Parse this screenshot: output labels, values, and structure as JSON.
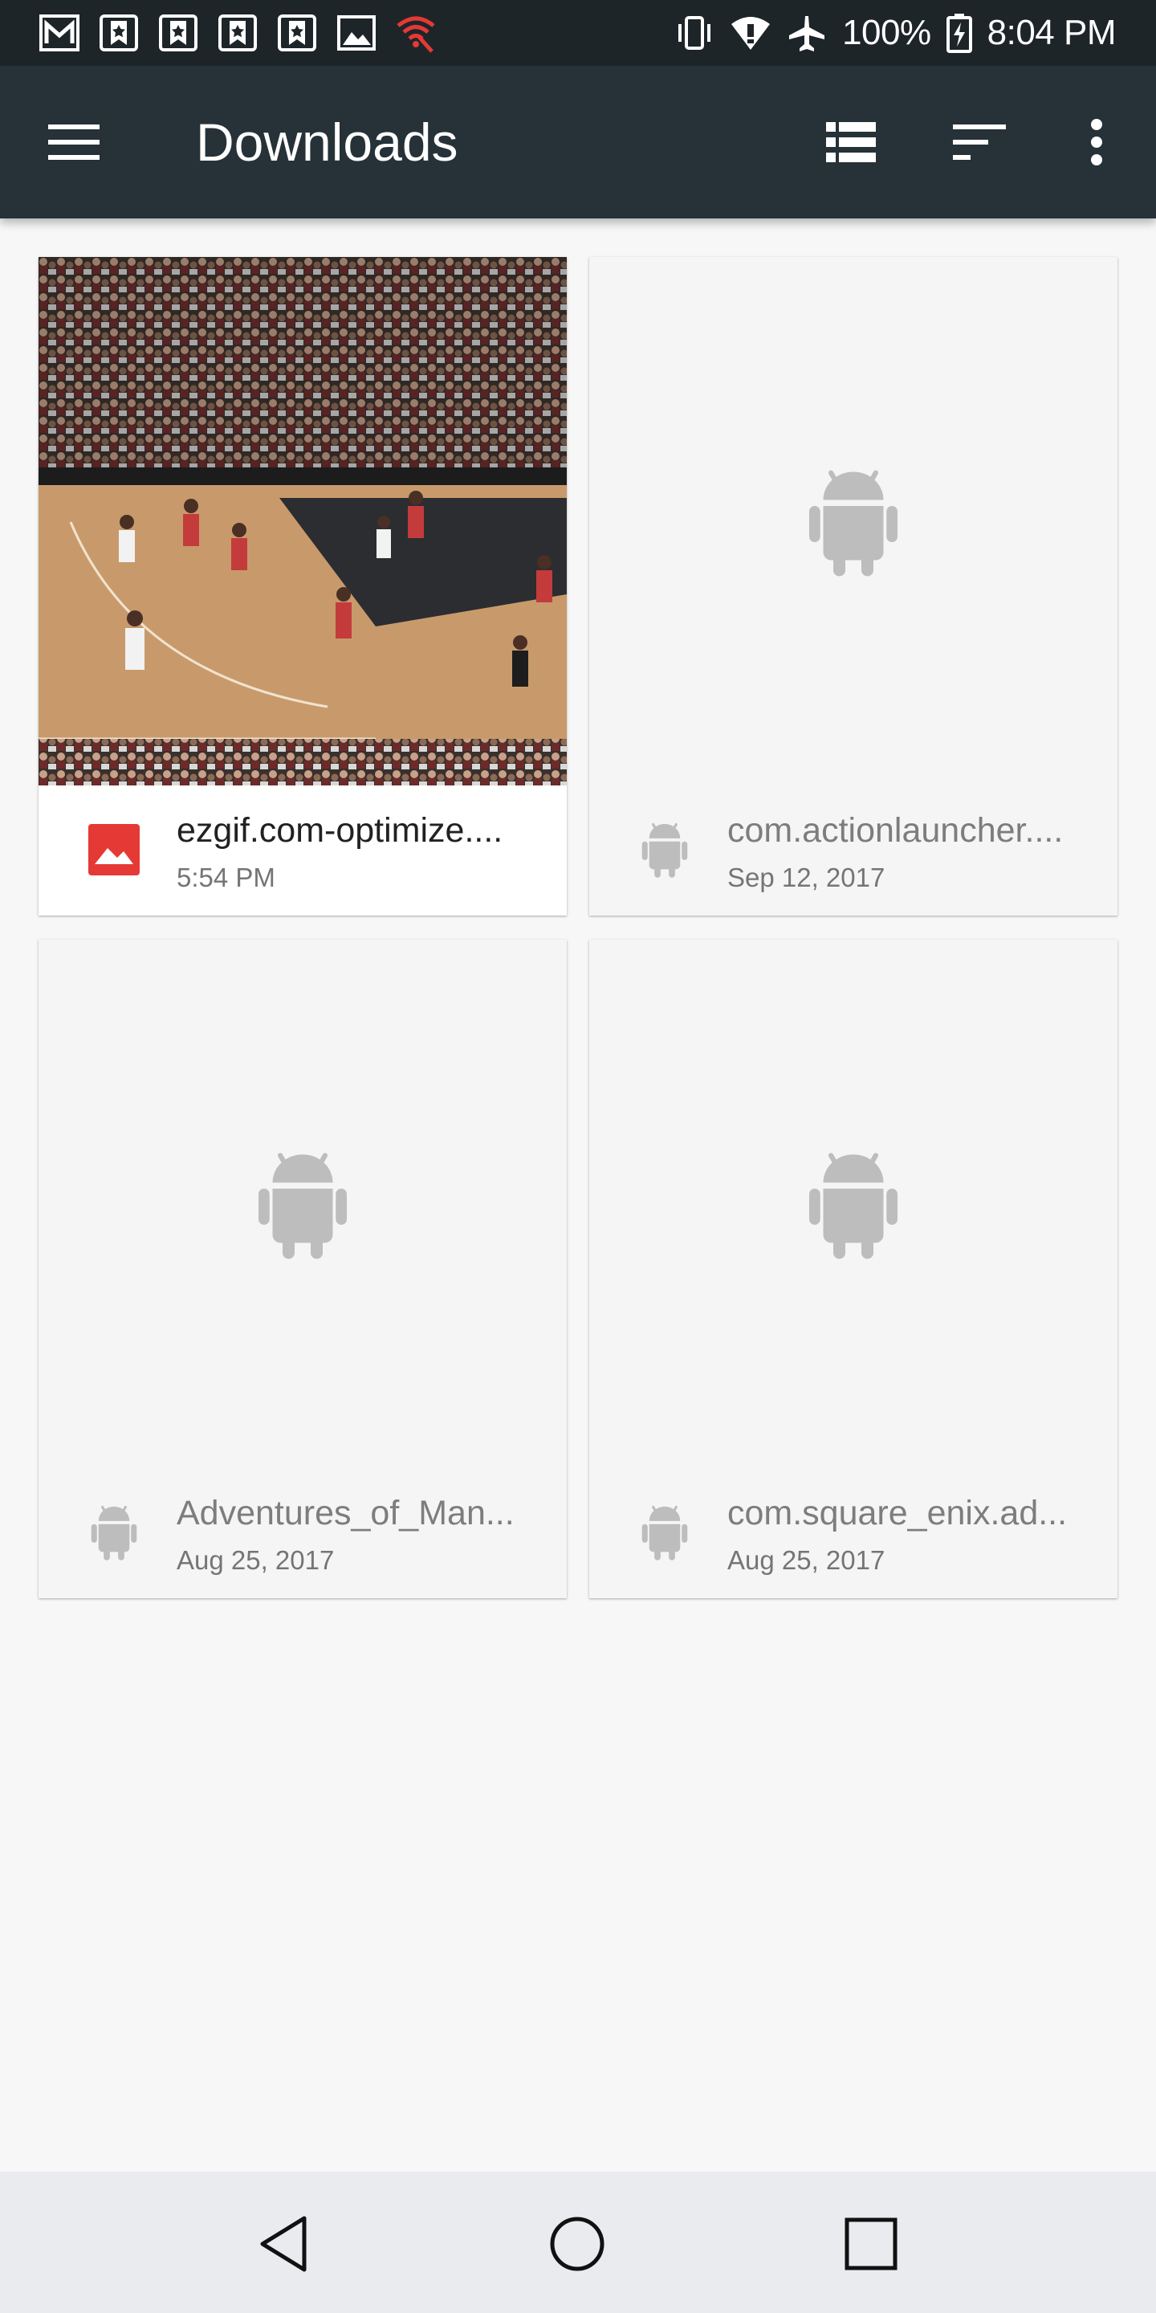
{
  "status_bar": {
    "battery": "100%",
    "time": "8:04 PM",
    "notification_icons": [
      "gmail-icon",
      "bookmark-star-icon",
      "bookmark-star-icon",
      "bookmark-star-icon",
      "bookmark-star-icon",
      "image-icon",
      "wifi-alert-icon"
    ],
    "system_icons": [
      "vibrate-icon",
      "wifi-icon",
      "airplane-icon",
      "battery-charging-icon"
    ]
  },
  "app_bar": {
    "title": "Downloads",
    "actions": [
      "menu-icon",
      "list-view-icon",
      "sort-icon",
      "more-vert-icon"
    ]
  },
  "files": [
    {
      "name": "ezgif.com-optimize....",
      "date": "5:54 PM",
      "type": "image",
      "icon": "image-file-icon",
      "thumbnail": "basketball-game-photo"
    },
    {
      "name": "com.actionlauncher....",
      "date": "Sep 12, 2017",
      "type": "apk",
      "icon": "android-icon"
    },
    {
      "name": "Adventures_of_Man...",
      "date": "Aug 25, 2017",
      "type": "apk",
      "icon": "android-icon"
    },
    {
      "name": "com.square_enix.ad...",
      "date": "Aug 25, 2017",
      "type": "apk",
      "icon": "android-icon"
    }
  ],
  "nav_bar": [
    "back-icon",
    "home-icon",
    "recents-icon"
  ],
  "colors": {
    "status_bar": "#1d2529",
    "app_bar": "#263238",
    "background": "#f7f7f7",
    "image_icon": "#e53935",
    "placeholder_icon": "#bdbdbd",
    "wifi_alert": "#e53935"
  }
}
